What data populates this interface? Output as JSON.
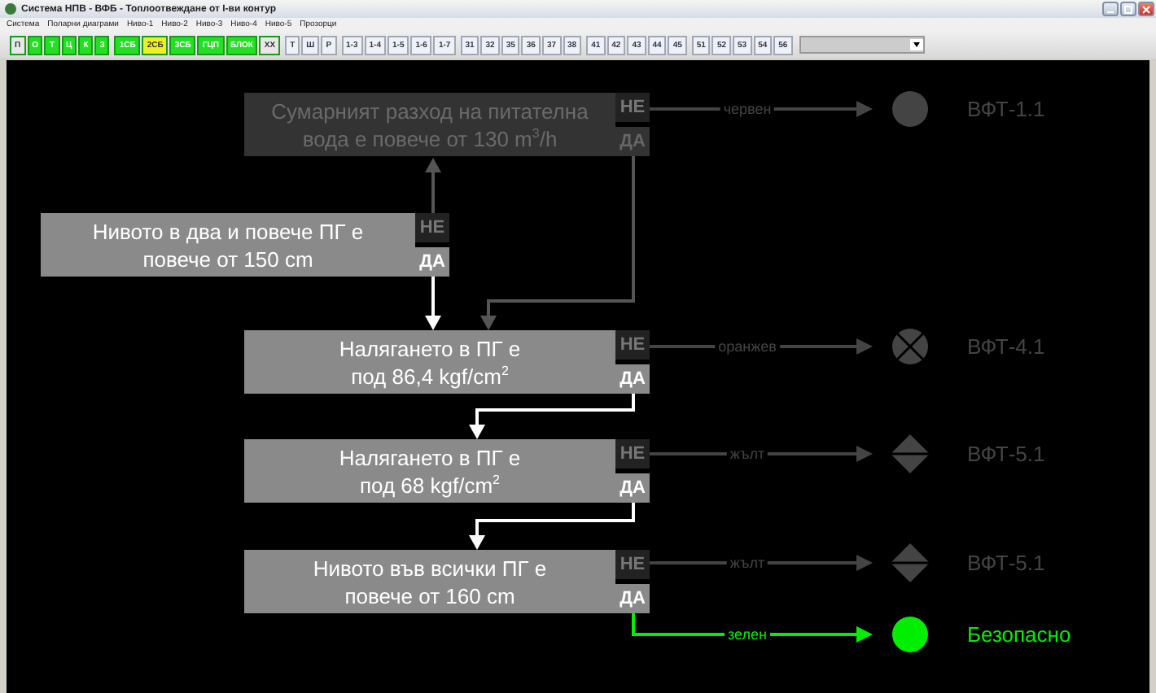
{
  "window": {
    "title": "Система НПВ  -  ВФБ - Топлоотвеждане от I-ви контур"
  },
  "menu": [
    "Система",
    "Поларни диаграми",
    "Ниво-1",
    "Ниво-2",
    "Ниво-3",
    "Ниво-4",
    "Ниво-5",
    "Прозорци"
  ],
  "toolbar": {
    "groups": [
      [
        {
          "label": "П",
          "color": "#e8e8e8"
        },
        {
          "label": "О",
          "color": "#22e022"
        },
        {
          "label": "Т",
          "color": "#22e022"
        },
        {
          "label": "Ц",
          "color": "#22e022"
        },
        {
          "label": "К",
          "color": "#22e022"
        },
        {
          "label": "З",
          "color": "#22e022"
        }
      ],
      [
        {
          "label": "1СБ",
          "color": "#22e022"
        },
        {
          "label": "2СБ",
          "color": "#f0f020"
        },
        {
          "label": "3СБ",
          "color": "#22e022"
        },
        {
          "label": "ГЦП",
          "color": "#22e022"
        },
        {
          "label": "БЛОК",
          "color": "#22e022"
        },
        {
          "label": "ХХ",
          "color": "#e8e8e8"
        }
      ],
      [
        {
          "label": "Т"
        },
        {
          "label": "Ш"
        },
        {
          "label": "Р"
        }
      ],
      [
        {
          "label": "1-3"
        },
        {
          "label": "1-4"
        },
        {
          "label": "1-5"
        },
        {
          "label": "1-6"
        },
        {
          "label": "1-7"
        }
      ],
      [
        {
          "label": "31"
        },
        {
          "label": "32"
        },
        {
          "label": "35"
        },
        {
          "label": "36"
        },
        {
          "label": "37"
        },
        {
          "label": "38"
        }
      ],
      [
        {
          "label": "41"
        },
        {
          "label": "42"
        },
        {
          "label": "43"
        },
        {
          "label": "44"
        },
        {
          "label": "45"
        }
      ],
      [
        {
          "label": "51"
        },
        {
          "label": "52"
        },
        {
          "label": "53"
        },
        {
          "label": "54"
        },
        {
          "label": "56"
        }
      ]
    ]
  },
  "nodes": [
    {
      "text": "Сумарният разход на питателна\nвода е повече от 130 m$^{3}$/h",
      "no": "НЕ",
      "yes": "ДА",
      "active": false
    },
    {
      "text": "Нивото в два и повече ПГ е\nповече от 150 cm",
      "no": "НЕ",
      "yes": "ДА",
      "active": true
    },
    {
      "text": "Налягането в ПГ е\nпод 86,4 kgf/cm$^{2}$",
      "no": "НЕ",
      "yes": "ДА",
      "active": true
    },
    {
      "text": "Налягането в ПГ е\nпод 68 kgf/cm$^{2}$",
      "no": "НЕ",
      "yes": "ДА",
      "active": true
    },
    {
      "text": "Нивото във всички ПГ е\nповече от 160 cm",
      "no": "НЕ",
      "yes": "ДА",
      "active": true
    }
  ],
  "outcomes": [
    {
      "path_label": "червен",
      "kind": "circle",
      "label": "ВФТ-1.1",
      "active": false
    },
    {
      "path_label": "оранжев",
      "kind": "cross-circle",
      "label": "ВФТ-4.1",
      "active": false
    },
    {
      "path_label": "жълт",
      "kind": "diamond",
      "label": "ВФТ-5.1",
      "active": false
    },
    {
      "path_label": "жълт",
      "kind": "diamond",
      "label": "ВФТ-5.1",
      "active": false
    },
    {
      "path_label": "зелен",
      "kind": "circle",
      "label": "Безопасно",
      "active": true
    }
  ]
}
